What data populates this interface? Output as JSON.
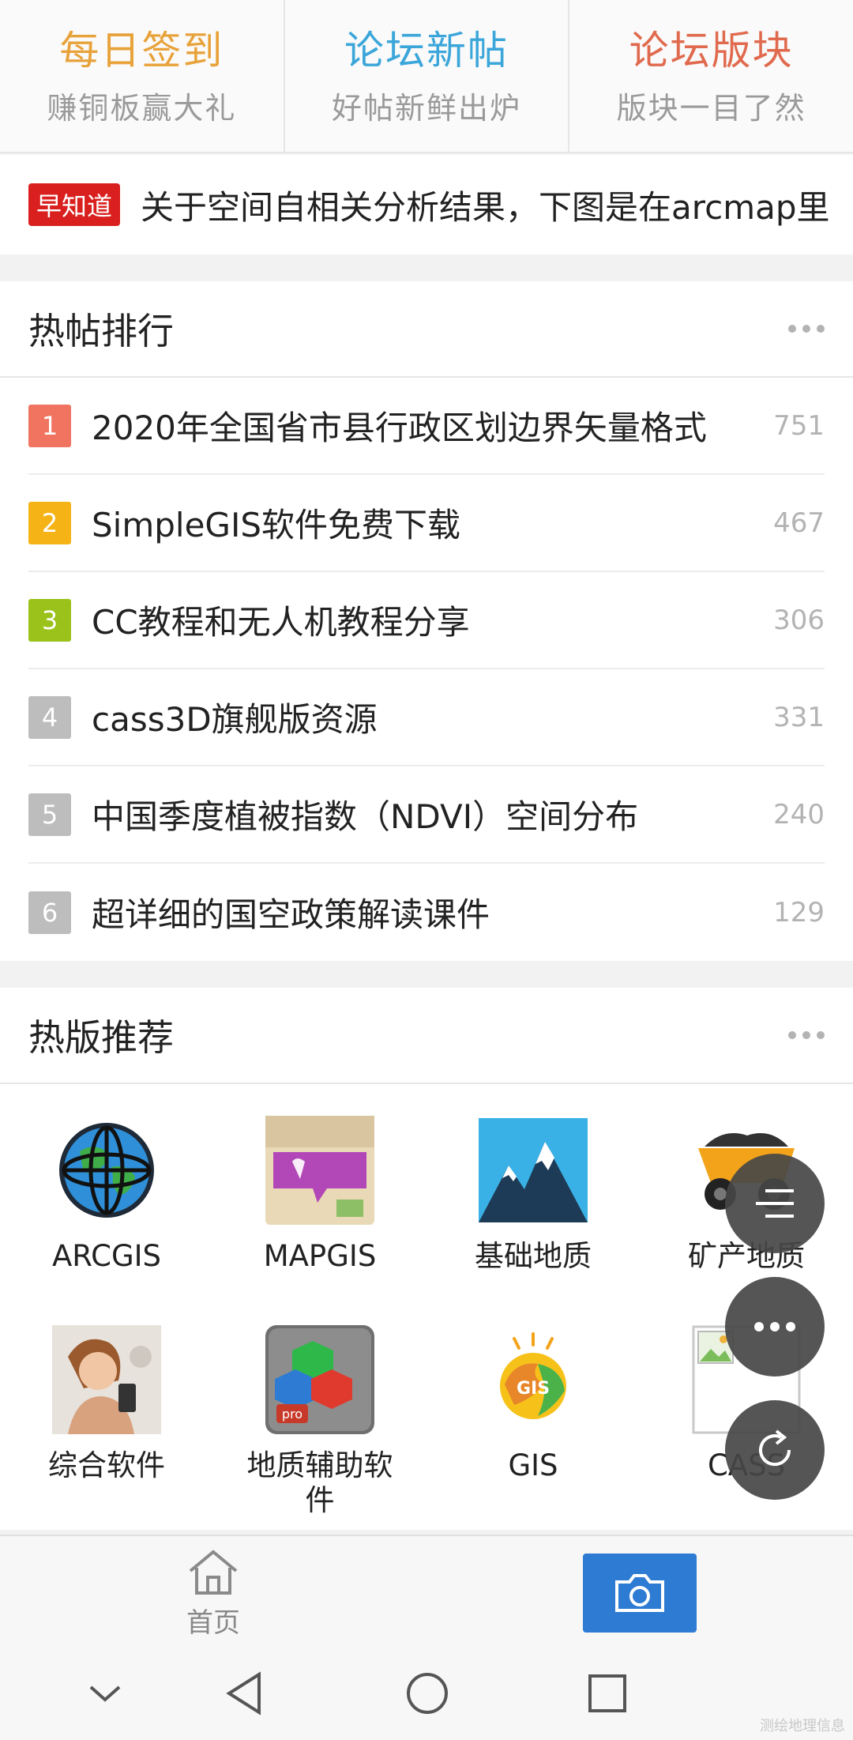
{
  "tiles": [
    {
      "title": "每日签到",
      "sub": "赚铜板赢大礼",
      "color": "#e8a23a"
    },
    {
      "title": "论坛新帖",
      "sub": "好帖新鲜出炉",
      "color": "#3ba6d9"
    },
    {
      "title": "论坛版块",
      "sub": "版块一目了然",
      "color": "#e06a4e"
    }
  ],
  "ticker": {
    "badge": "早知道",
    "text": "关于空间自相关分析结果，下图是在arcmap里"
  },
  "hot_posts": {
    "title": "热帖排行",
    "items": [
      {
        "rank": "1",
        "title": "2020年全国省市县行政区划边界矢量格式",
        "count": "751",
        "color": "#f07460"
      },
      {
        "rank": "2",
        "title": "SimpleGIS软件免费下载",
        "count": "467",
        "color": "#f5b316"
      },
      {
        "rank": "3",
        "title": "CC教程和无人机教程分享",
        "count": "306",
        "color": "#9ac21a"
      },
      {
        "rank": "4",
        "title": "cass3D旗舰版资源",
        "count": "331",
        "color": "#bdbdbd"
      },
      {
        "rank": "5",
        "title": "中国季度植被指数（NDVI）空间分布",
        "count": "240",
        "color": "#bdbdbd"
      },
      {
        "rank": "6",
        "title": "超详细的国空政策解读课件",
        "count": "129",
        "color": "#bdbdbd"
      }
    ]
  },
  "hot_boards": {
    "title": "热版推荐",
    "items": [
      {
        "label": "ARCGIS",
        "icon": "globe-icon"
      },
      {
        "label": "MAPGIS",
        "icon": "mapgis-logo-icon"
      },
      {
        "label": "基础地质",
        "icon": "mountain-icon"
      },
      {
        "label": "矿产地质",
        "icon": "mining-truck-icon"
      },
      {
        "label": "综合软件",
        "icon": "woman-phone-photo-icon"
      },
      {
        "label": "地质辅助软件",
        "icon": "office-cubes-icon"
      },
      {
        "label": "GIS",
        "icon": "gis-logo-icon"
      },
      {
        "label": "CASS",
        "icon": "broken-image-icon"
      }
    ]
  },
  "tabbar": {
    "home_label": "首页"
  },
  "watermark": "测绘地理信息"
}
